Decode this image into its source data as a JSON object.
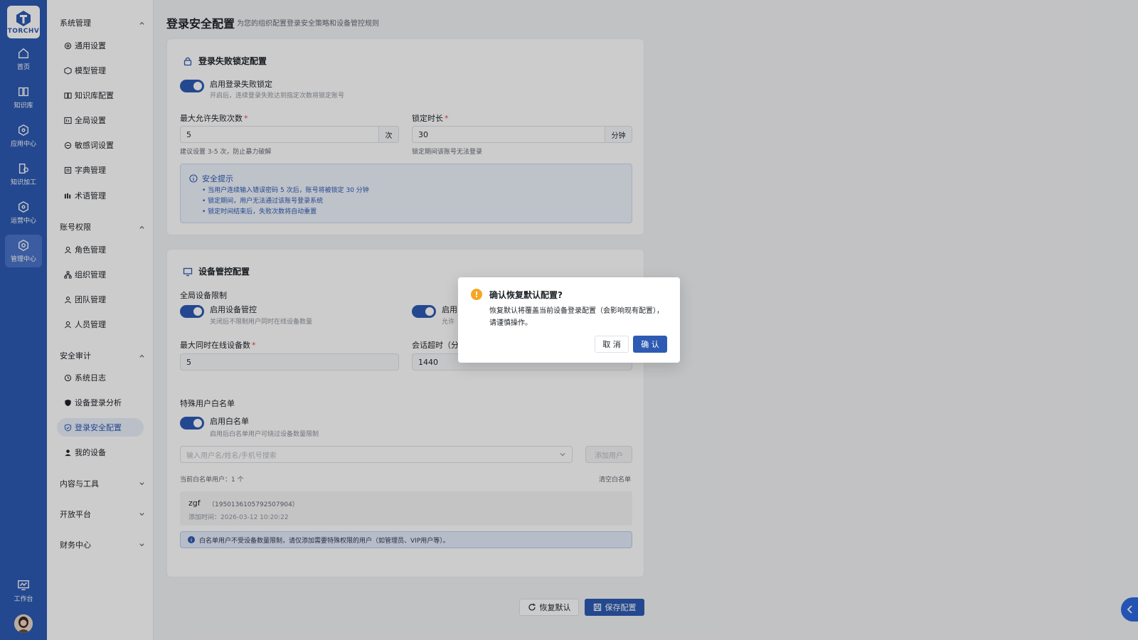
{
  "brand": {
    "logo_text": "TORCHV",
    "accent": "#2d5bb3"
  },
  "rail": {
    "items": [
      {
        "label": "首页",
        "icon": "home-icon"
      },
      {
        "label": "知识库",
        "icon": "book-icon"
      },
      {
        "label": "应用中心",
        "icon": "cube-icon"
      },
      {
        "label": "知识加工",
        "icon": "document-process-icon"
      },
      {
        "label": "运营中心",
        "icon": "cube-icon"
      },
      {
        "label": "管理中心",
        "icon": "settings-hex-icon"
      }
    ],
    "workspace_label": "工作台"
  },
  "subnav": {
    "groups": [
      {
        "label": "系统管理",
        "expanded": true
      },
      {
        "label": "账号权限",
        "expanded": true
      },
      {
        "label": "安全审计",
        "expanded": true
      },
      {
        "label": "内容与工具",
        "expanded": false
      },
      {
        "label": "开放平台",
        "expanded": false
      },
      {
        "label": "财务中心",
        "expanded": false
      }
    ],
    "items": [
      "通用设置",
      "模型管理",
      "知识库配置",
      "全局设置",
      "敏感词设置",
      "字典管理",
      "术语管理",
      "角色管理",
      "组织管理",
      "团队管理",
      "人员管理",
      "系统日志",
      "设备登录分析",
      "登录安全配置",
      "我的设备"
    ],
    "active_item": "登录安全配置"
  },
  "page": {
    "title": "登录安全配置",
    "subtitle": "为您的组织配置登录安全策略和设备管控规则"
  },
  "lockout": {
    "title": "登录失败锁定配置",
    "toggle_label": "启用登录失败锁定",
    "toggle_hint": "开启后，连续登录失败达到指定次数将锁定账号",
    "toggle_on": true,
    "max_fail_label": "最大允许失败次数",
    "max_fail_value": "5",
    "max_fail_unit": "次",
    "max_fail_hint": "建议设置 3-5 次，防止暴力破解",
    "lock_duration_label": "锁定时长",
    "lock_duration_value": "30",
    "lock_duration_unit": "分钟",
    "lock_duration_hint": "锁定期间该账号无法登录",
    "tip_title": "安全提示",
    "tips": [
      "• 当用户连续输入错误密码 5 次后，账号将被锁定 30 分钟",
      "• 锁定期间，用户无法通过该账号登录系统",
      "• 锁定时间结束后，失败次数将自动重置"
    ]
  },
  "device": {
    "title": "设备管控配置",
    "global_limit_label": "全局设备限制",
    "toggle1_label": "启用设备管控",
    "toggle1_hint": "关闭后不限制用户同时在线设备数量",
    "toggle1_on": true,
    "toggle2_label": "启用",
    "toggle2_hint": "允许",
    "toggle2_on": true,
    "max_online_label": "最大同时在线设备数",
    "max_online_value": "5",
    "session_timeout_label": "会话超时（分",
    "session_timeout_value": "1440",
    "whitelist_label": "特殊用户白名单",
    "wl_toggle_label": "启用白名单",
    "wl_toggle_hint": "启用后白名单用户可绕过设备数量限制",
    "wl_toggle_on": true,
    "search_placeholder": "输入用户名/姓名/手机号搜索",
    "add_user_label": "添加用户",
    "wl_count_text": "当前白名单用户：1 个",
    "wl_clear_label": "清空白名单",
    "wl_users": [
      {
        "name": "zgf",
        "id": "（1950136105792507904）",
        "added": "添加时间：2026-03-12 10:20:22"
      }
    ],
    "info_text": "白名单用户不受设备数量限制，请仅添加需要特殊权限的用户（如管理员、VIP用户等）。"
  },
  "footer": {
    "reset_label": "恢复默认",
    "save_label": "保存配置"
  },
  "dialog": {
    "icon_text": "!",
    "title": "确认恢复默认配置?",
    "body": "恢复默认将覆盖当前设备登录配置（会影响现有配置），请谨慎操作。",
    "cancel_label": "取 消",
    "ok_label": "确 认",
    "icon_color": "#f5a623"
  }
}
